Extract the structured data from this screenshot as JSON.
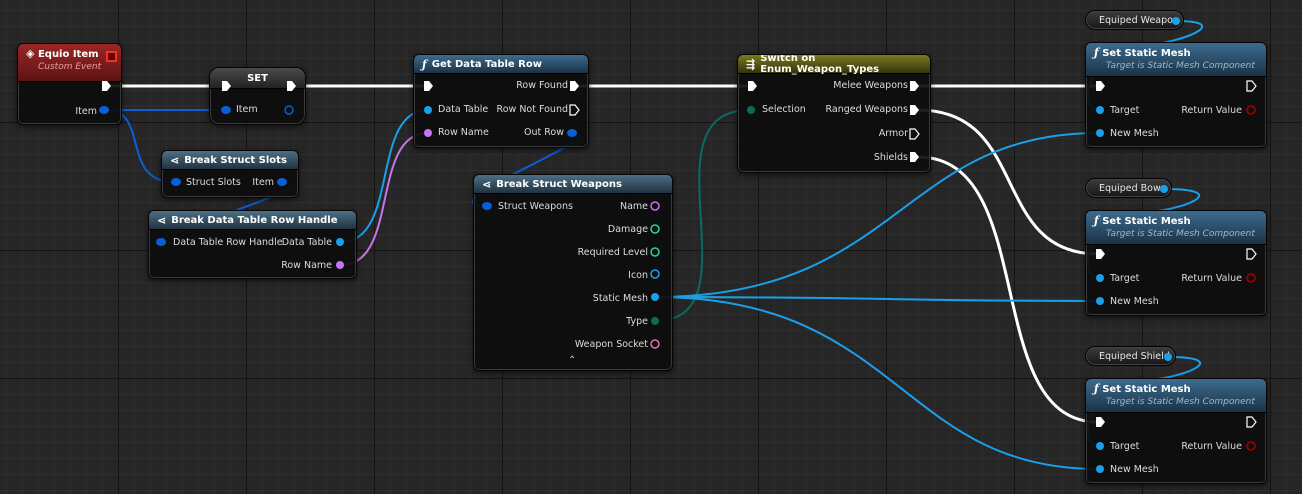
{
  "nodes": {
    "equip_event": {
      "title": "Equio Item",
      "subtitle": "Custom Event",
      "item_pin": "Item"
    },
    "set": {
      "title": "SET",
      "item_pin": "Item"
    },
    "break_slots": {
      "title": "Break Struct Slots",
      "in_pin": "Struct Slots",
      "out_pin": "Item"
    },
    "break_handle": {
      "title": "Break Data Table Row Handle",
      "in_pin": "Data Table Row Handle",
      "out_table": "Data Table",
      "out_row": "Row Name"
    },
    "get_row": {
      "title": "Get Data Table Row",
      "in_table": "Data Table",
      "in_row": "Row Name",
      "out_found": "Row Found",
      "out_not_found": "Row Not Found",
      "out_row": "Out Row"
    },
    "break_weapons": {
      "title": "Break Struct Weapons",
      "in_pin": "Struct Weapons",
      "outs": [
        "Name",
        "Damage",
        "Required Level",
        "Icon",
        "Static Mesh",
        "Type",
        "Weapon Socket"
      ]
    },
    "switch": {
      "title": "Switch on Enum_Weapon_Types",
      "in_sel": "Selection",
      "outs": [
        "Melee Weapons",
        "Ranged Weapons",
        "Armor",
        "Shields"
      ]
    },
    "set_mesh": {
      "title": "Set Static Mesh",
      "subtitle": "Target is Static Mesh Component",
      "target": "Target",
      "return": "Return Value",
      "new_mesh": "New Mesh"
    },
    "vars": {
      "weapon": "Equiped  Weapon",
      "bow": "Equiped Bow",
      "shield": "Equiped Shield"
    }
  },
  "colors": {
    "exec": "#ffffff",
    "struct": "#0a5ed8",
    "object": "#1aa0ea",
    "name": "#c874ec",
    "byte": "#0b6b5e",
    "int": "#22d89a",
    "text": "#e070b0",
    "bool_red": "#8a0000"
  }
}
